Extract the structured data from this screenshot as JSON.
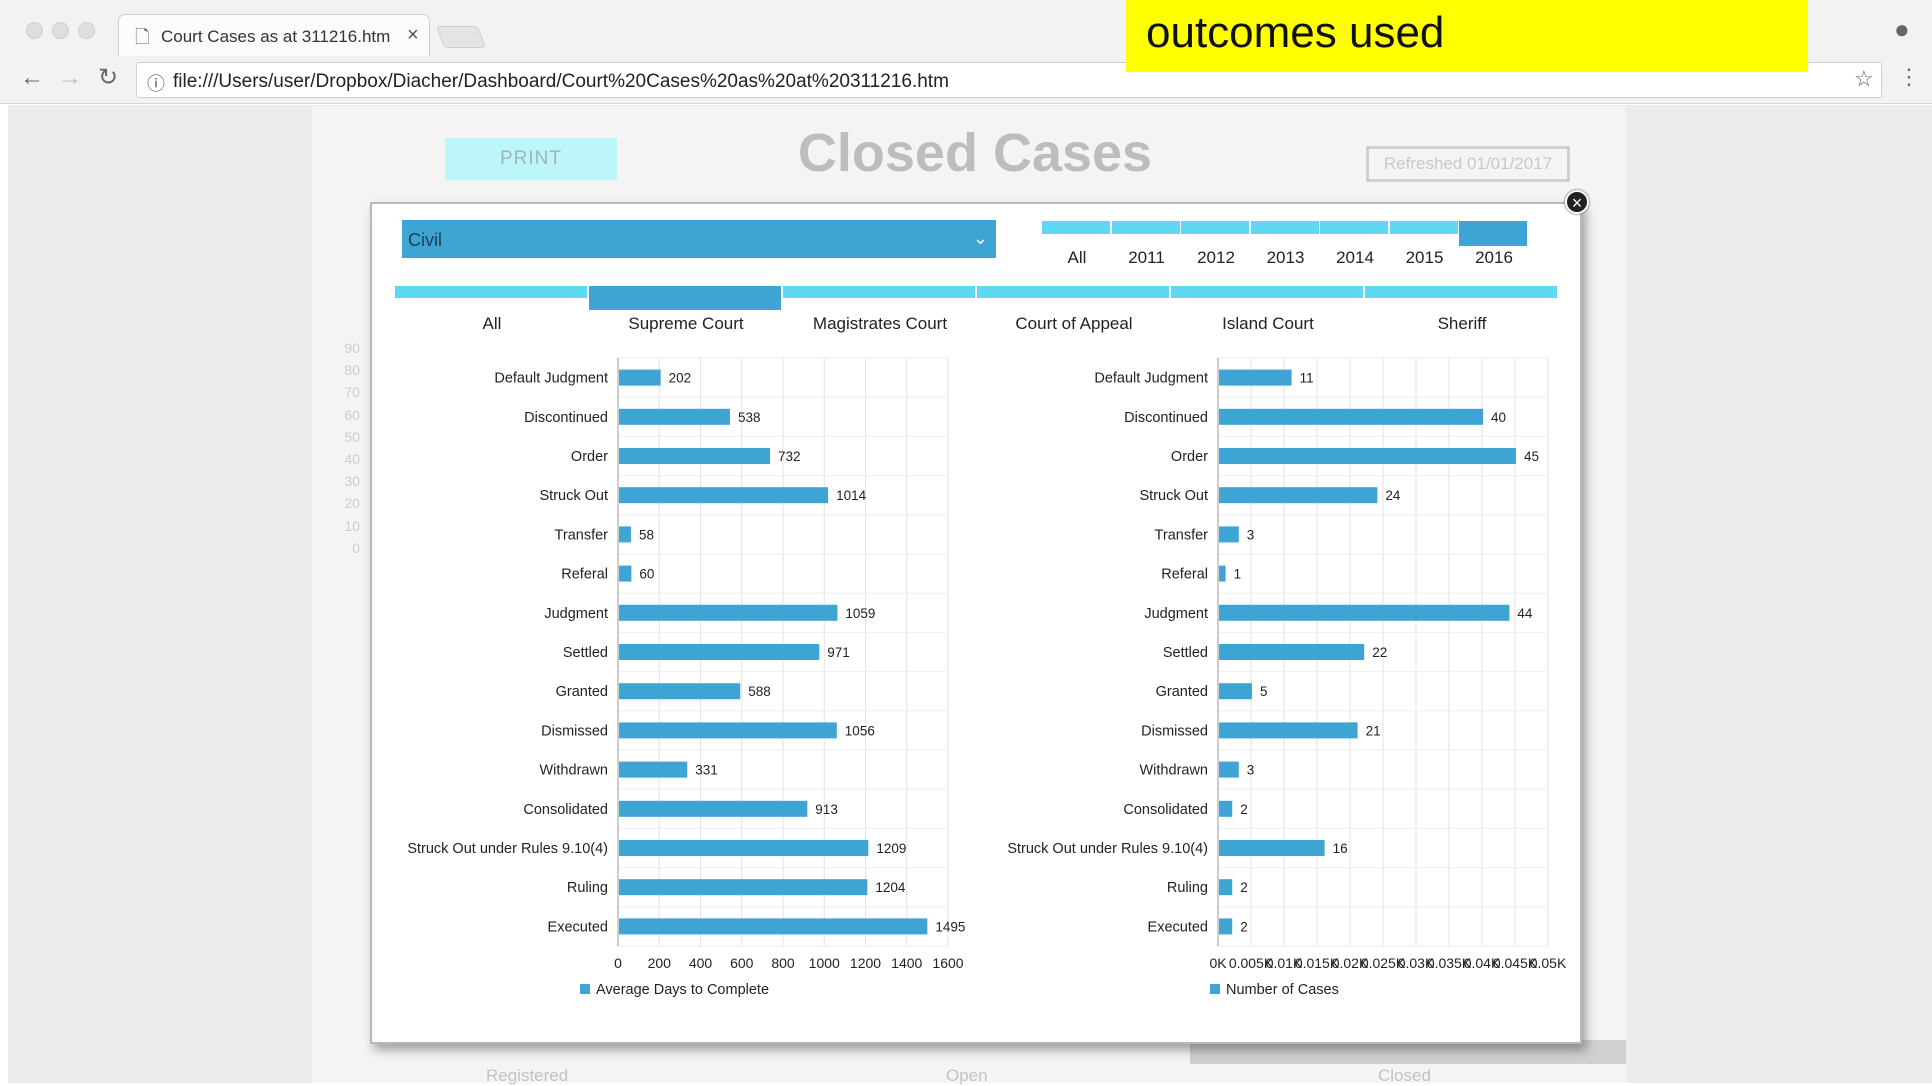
{
  "browser": {
    "tab_title": "Court Cases as at 311216.htm",
    "url": "file:///Users/user/Dropbox/Diacher/Dashboard/Court%20Cases%20as%20at%20311216.htm"
  },
  "banner": {
    "line": "outcomes used",
    "color": "#ffff00"
  },
  "dashboard": {
    "print_label": "PRINT",
    "title": "Closed Cases",
    "refreshed": "Refreshed 01/01/2017",
    "bg_ticks": [
      "90",
      "80",
      "70",
      "60",
      "50",
      "40",
      "30",
      "20",
      "10",
      "0"
    ],
    "bottom_tabs": [
      "Registered",
      "Open",
      "Closed"
    ]
  },
  "filters": {
    "case_type": "Civil",
    "years": [
      "All",
      "2011",
      "2012",
      "2013",
      "2014",
      "2015",
      "2016"
    ],
    "selected_year": "2016",
    "courts": [
      "All",
      "Supreme Court",
      "Magistrates Court",
      "Court of Appeal",
      "Island Court",
      "Sheriff"
    ],
    "selected_court": "Supreme Court"
  },
  "colors": {
    "accent": "#3da4d3",
    "light": "#5fd9f2",
    "bar": "#3da4d3"
  },
  "chart_data": [
    {
      "type": "bar",
      "orientation": "horizontal",
      "categories": [
        "Default Judgment",
        "Discontinued",
        "Order",
        "Struck Out",
        "Transfer",
        "Referal",
        "Judgment",
        "Settled",
        "Granted",
        "Dismissed",
        "Withdrawn",
        "Consolidated",
        "Struck Out under Rules 9.10(4)",
        "Ruling",
        "Executed"
      ],
      "series": [
        {
          "name": "Average Days to Complete",
          "values": [
            202,
            538,
            732,
            1014,
            58,
            60,
            1059,
            971,
            588,
            1056,
            331,
            913,
            1209,
            1204,
            1495
          ]
        }
      ],
      "xlim": [
        0,
        1600
      ],
      "xticks": [
        "0",
        "200",
        "400",
        "600",
        "800",
        "1000",
        "1200",
        "1400",
        "1600"
      ],
      "grid": true,
      "legend": "bottom"
    },
    {
      "type": "bar",
      "orientation": "horizontal",
      "categories": [
        "Default Judgment",
        "Discontinued",
        "Order",
        "Struck Out",
        "Transfer",
        "Referal",
        "Judgment",
        "Settled",
        "Granted",
        "Dismissed",
        "Withdrawn",
        "Consolidated",
        "Struck Out under Rules 9.10(4)",
        "Ruling",
        "Executed"
      ],
      "series": [
        {
          "name": "Number of Cases",
          "values": [
            11,
            40,
            45,
            24,
            3,
            1,
            44,
            22,
            5,
            21,
            3,
            2,
            16,
            2,
            2
          ]
        }
      ],
      "xlim": [
        0,
        50
      ],
      "xticks": [
        "0K",
        "0.005K",
        "0.01K",
        "0.015K",
        "0.02K",
        "0.025K",
        "0.03K",
        "0.035K",
        "0.04K",
        "0.045K",
        "0.05K"
      ],
      "grid": true,
      "legend": "bottom"
    }
  ]
}
